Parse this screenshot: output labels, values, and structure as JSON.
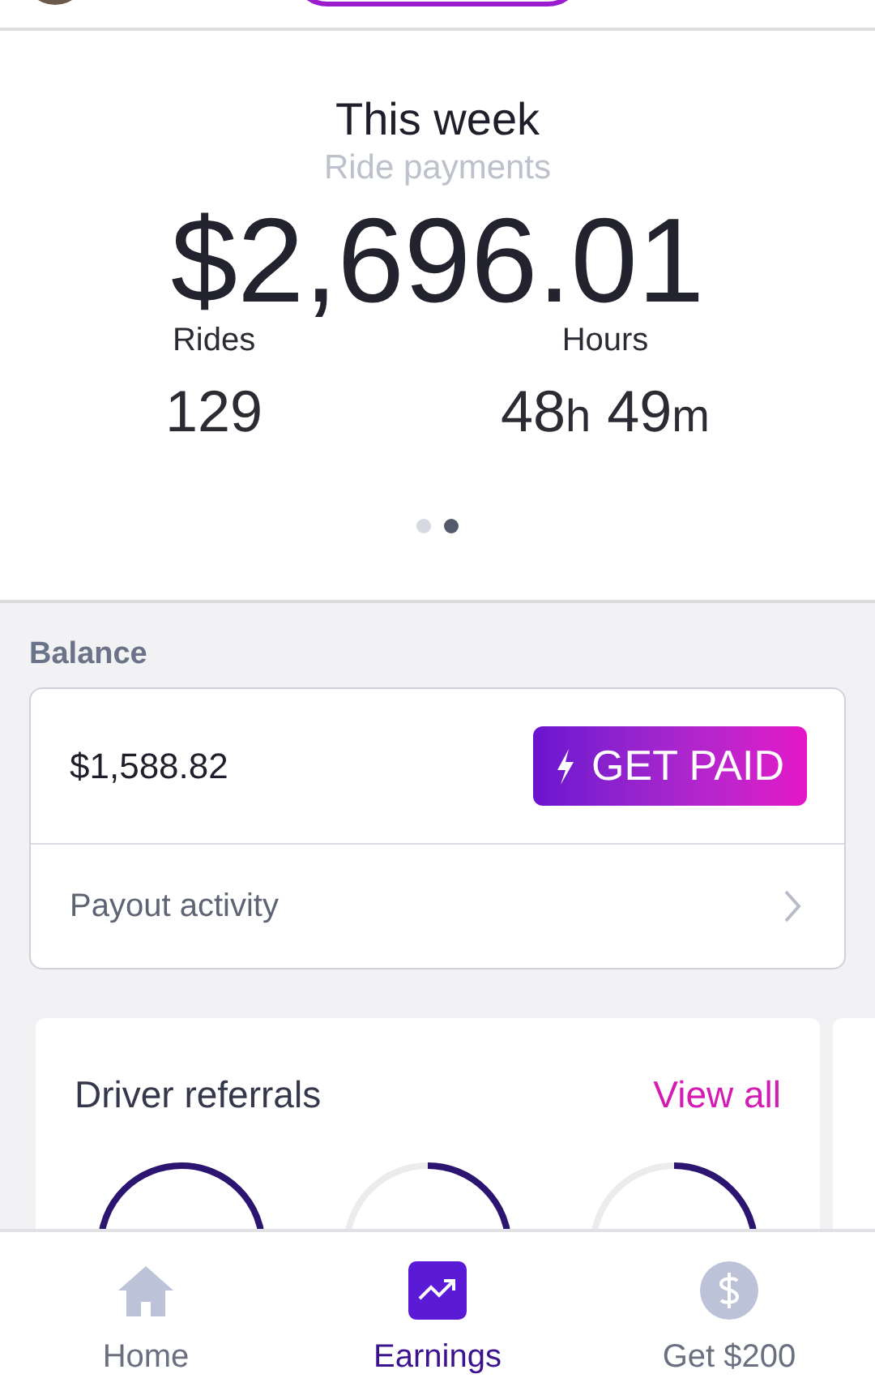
{
  "summary": {
    "title": "This week",
    "subtitle": "Ride payments",
    "amount": "$2,696.01",
    "stats": [
      {
        "label": "Rides",
        "value": [
          {
            "text": "129",
            "kind": "number"
          }
        ]
      },
      {
        "label": "Hours",
        "value": [
          {
            "text": "48",
            "kind": "number"
          },
          {
            "text": "h",
            "kind": "unit"
          },
          {
            "text": " 49",
            "kind": "number"
          },
          {
            "text": "m",
            "kind": "unit"
          }
        ]
      }
    ],
    "pager": [
      {
        "selected": false
      },
      {
        "selected": true
      }
    ]
  },
  "balance": {
    "heading": "Balance",
    "amount": "$1,588.82",
    "button": "GET PAID",
    "link": "Payout activity"
  },
  "referrals": {
    "title": "Driver referrals",
    "action": "View all"
  },
  "nav": [
    {
      "label": "Home",
      "kind": "home",
      "selected": false
    },
    {
      "label": "Earnings",
      "kind": "earnings",
      "selected": true
    },
    {
      "label": "Get $200",
      "kind": "dollar",
      "selected": false
    }
  ]
}
